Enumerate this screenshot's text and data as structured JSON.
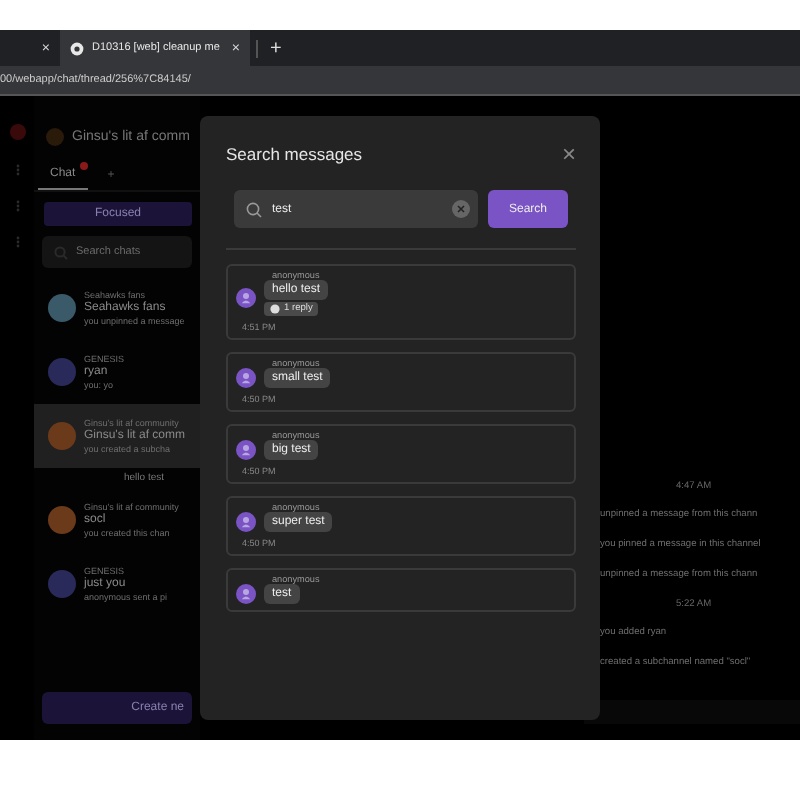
{
  "browser": {
    "tabs": [
      {
        "close": "×",
        "selected": false
      },
      {
        "title": "D10316 [web] cleanup me",
        "close": "×",
        "selected": true
      }
    ],
    "new_tab": "+",
    "address": "00/webapp/chat/thread/256%7C84145/"
  },
  "sidebar": {
    "channel_title": "Ginsu's lit af comm",
    "tabs": [
      {
        "label": "Chat",
        "selected": true,
        "badge": true
      },
      {
        "label": "+",
        "selected": false,
        "badge": false
      }
    ],
    "focused_button": "Focused",
    "search": {
      "placeholder": "Search chats"
    },
    "chats": [
      {
        "group": "Seahawks fans",
        "name": "Seahawks fans",
        "preview": "you unpinned a message",
        "selected": false,
        "color": "#3a5a6a"
      },
      {
        "group": "GENESIS",
        "name": "ryan",
        "preview": "you: yo",
        "selected": false,
        "color": "#2a2a5a"
      },
      {
        "group": "Ginsu's lit af community",
        "name": "Ginsu's lit af comm",
        "preview": "you created a subcha",
        "selected": true,
        "color": "#6a3a1a",
        "thread": "hello test"
      },
      {
        "group": "Ginsu's lit af community",
        "name": "socl",
        "preview": "you created this chan",
        "selected": false,
        "color": "#6a3a1a"
      },
      {
        "group": "GENESIS",
        "name": "just you",
        "preview": "anonymous sent a pi",
        "selected": false,
        "color": "#2a2a5a"
      }
    ],
    "create_button": "Create ne"
  },
  "main": {
    "events": [
      {
        "kind": "time",
        "text": "4:47 AM"
      },
      {
        "kind": "event",
        "text": "unpinned a message from this chann"
      },
      {
        "kind": "event",
        "text": "you pinned a message in this channel"
      },
      {
        "kind": "event",
        "text": "unpinned a message from this chann"
      },
      {
        "kind": "time",
        "text": "5:22 AM"
      },
      {
        "kind": "event",
        "text": "you added ryan"
      },
      {
        "kind": "event",
        "text": "created a subchannel named \"socl\""
      }
    ]
  },
  "modal": {
    "title": "Search messages",
    "close": "×",
    "search": {
      "value": "test"
    },
    "search_button": "Search",
    "results": [
      {
        "author": "anonymous",
        "text": "hello test",
        "replies": "1 reply",
        "time": "4:51 PM"
      },
      {
        "author": "anonymous",
        "text": "small test",
        "time": "4:50 PM"
      },
      {
        "author": "anonymous",
        "text": "big test",
        "time": "4:50 PM"
      },
      {
        "author": "anonymous",
        "text": "super test",
        "time": "4:50 PM"
      },
      {
        "author": "anonymous",
        "text": "test"
      }
    ]
  }
}
